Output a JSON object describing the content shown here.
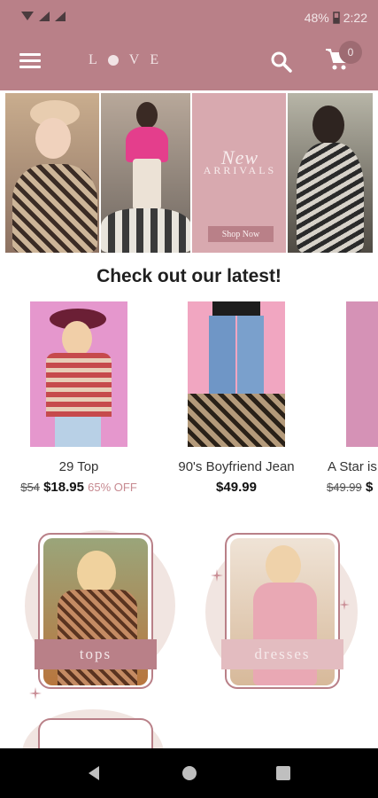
{
  "status": {
    "battery": "48%",
    "time": "2:22"
  },
  "appbar": {
    "logo_left": "L",
    "logo_right": "VE",
    "cart_count": "0",
    "menu_icon": "hamburger-icon",
    "search_icon": "search-icon",
    "cart_icon": "cart-icon"
  },
  "hero": {
    "new_label": "New",
    "arrivals_label": "ARRIVALS",
    "shop_now_label": "Shop Now"
  },
  "latest": {
    "title": "Check out our latest!",
    "products": [
      {
        "name": "29 Top",
        "old_price": "$54",
        "price": "$18.95",
        "discount": "65% OFF"
      },
      {
        "name": "90's Boyfriend Jean",
        "old_price": "",
        "price": "$49.99",
        "discount": ""
      },
      {
        "name": "A Star is",
        "old_price": "$49.99",
        "price": "$",
        "discount": ""
      }
    ]
  },
  "categories": [
    {
      "label": "tops"
    },
    {
      "label": "dresses"
    }
  ],
  "colors": {
    "brand": "#b98088",
    "accent": "#c78a91"
  }
}
